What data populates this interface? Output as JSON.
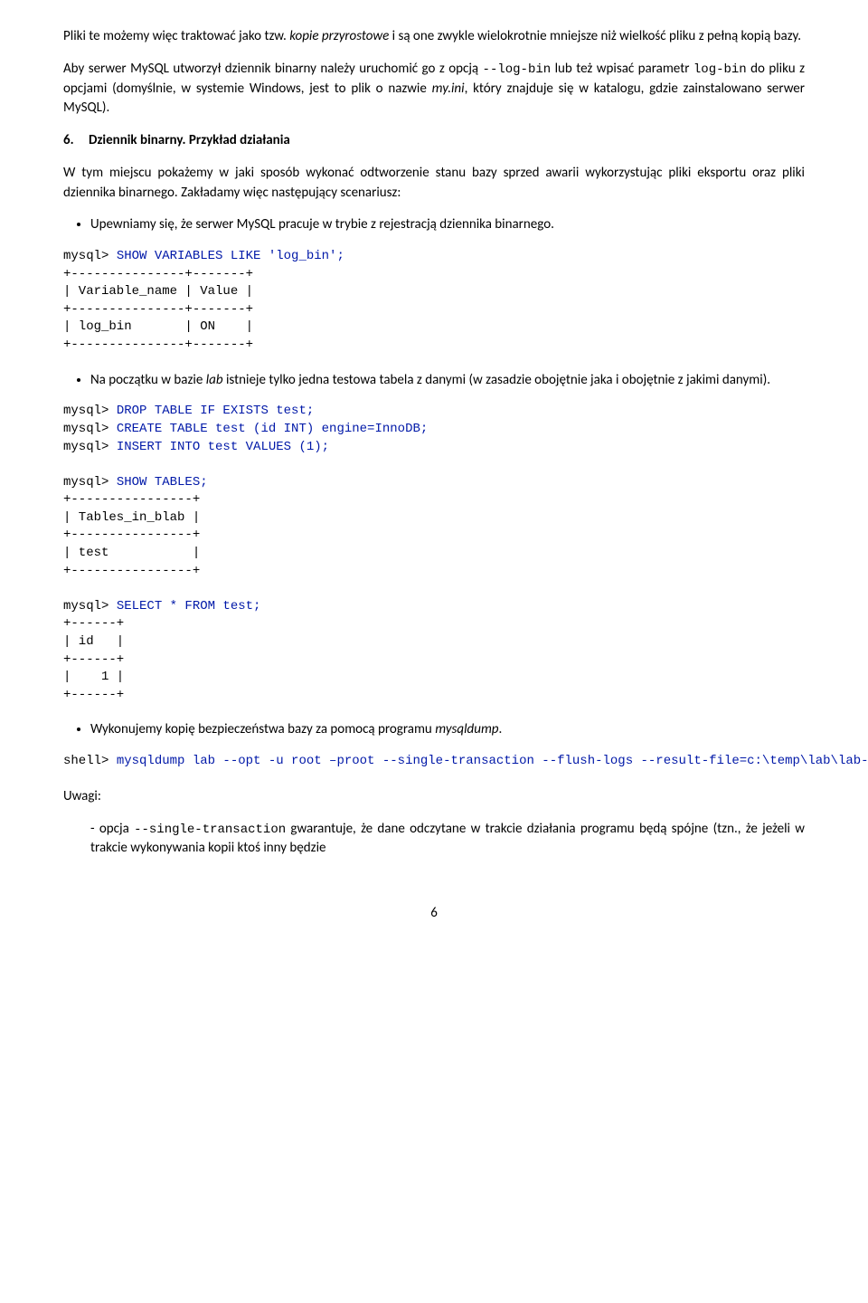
{
  "para1": {
    "t0": "Pliki te możemy więc traktować jako tzw. ",
    "i1": "kopie przyrostowe",
    "t2": " i są one zwykle wielokrotnie mniejsze niż wielkość pliku z pełną kopią bazy."
  },
  "para2": {
    "t0": "Aby serwer MySQL utworzył dziennik binarny należy uruchomić go z opcją ",
    "c1": "--log-bin",
    "t2": " lub też wpisać parametr ",
    "c3": "log-bin",
    "t4": " do pliku z opcjami (domyślnie, w systemie Windows, jest to plik o nazwie ",
    "i5": "my.ini",
    "t6": ", który znajduje się w katalogu, gdzie zainstalowano serwer MySQL)."
  },
  "heading": {
    "num": "6.",
    "title": "Dziennik binarny. Przykład działania"
  },
  "para3": "W tym miejscu pokażemy w jaki sposób wykonać odtworzenie stanu bazy sprzed awarii wykorzystując pliki eksportu oraz pliki dziennika binarnego. Zakładamy więc następujący scenariusz:",
  "bullet1": "Upewniamy się, że serwer MySQL pracuje w trybie z rejestracją dziennika binarnego.",
  "code1": {
    "sql": "SHOW VARIABLES LIKE 'log_bin';",
    "l2": "+---------------+-------+",
    "l3": "| Variable_name | Value |",
    "l4": "+---------------+-------+",
    "l5": "| log_bin       | ON    |",
    "l6": "+---------------+-------+"
  },
  "bullet2": {
    "t0": "Na początku w bazie ",
    "i1": "lab",
    "t2": " istnieje tylko jedna testowa tabela z danymi (w zasadzie obojętnie jaka i obojętnie z jakimi danymi)."
  },
  "code2": {
    "sql1": "DROP TABLE IF EXISTS test;",
    "sql2": "CREATE TABLE test (id INT) engine=InnoDB;",
    "sql3": "INSERT INTO test VALUES (1);",
    "sql4": "SHOW TABLES;",
    "l5": "+----------------+",
    "l6": "| Tables_in_blab |",
    "l7": "+----------------+",
    "l8": "| test           |",
    "l9": "+----------------+",
    "sql5": "SELECT * FROM test;",
    "l10": "+------+",
    "l11": "| id   |",
    "l12": "+------+",
    "l13": "|    1 |",
    "l14": "+------+"
  },
  "bullet3": {
    "t0": "Wykonujemy kopię bezpieczeństwa bazy za pomocą programu ",
    "i1": "mysqldump",
    "t2": "."
  },
  "code3": {
    "sql": "mysqldump lab --opt -u root –proot --single-transaction --flush-logs --result-file=c:\\temp\\lab\\lab-dump.sql"
  },
  "uwagi": "Uwagi:",
  "dash1": {
    "t0": "opcja ",
    "c1": "--single-transaction",
    "t2": " gwarantuje, że dane odczytane w trakcie działania programu będą spójne (tzn., że jeżeli w trakcie wykonywania kopii ktoś inny będzie"
  },
  "prompt": {
    "mysql": "mysql> ",
    "shell": "shell> "
  },
  "page_number": "6"
}
